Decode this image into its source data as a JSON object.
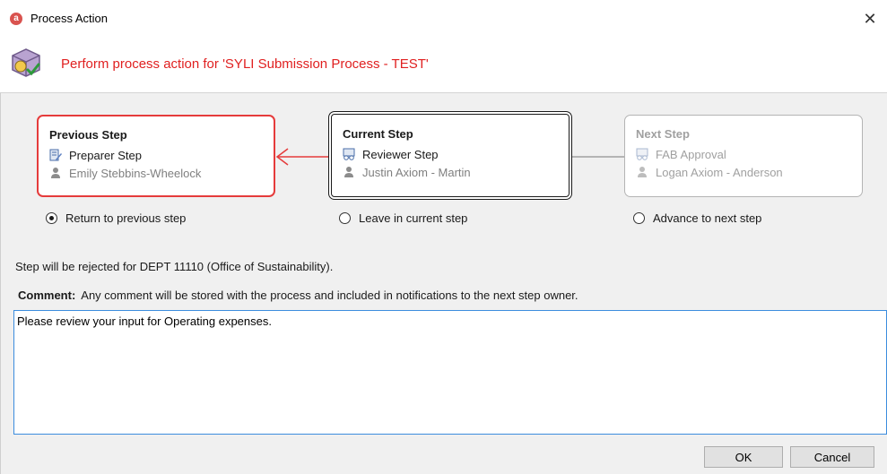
{
  "window": {
    "title": "Process Action",
    "app_icon_letter": "a",
    "close_label": "✕"
  },
  "header": {
    "text": "Perform process action for 'SYLI Submission Process - TEST'"
  },
  "steps": {
    "previous": {
      "heading": "Previous Step",
      "step_name": "Preparer Step",
      "user": "Emily Stebbins-Wheelock"
    },
    "current": {
      "heading": "Current Step",
      "step_name": "Reviewer Step",
      "user": "Justin Axiom - Martin"
    },
    "next": {
      "heading": "Next Step",
      "step_name": "FAB Approval",
      "user": "Logan Axiom - Anderson"
    }
  },
  "options": {
    "return_label": "Return to previous step",
    "leave_label": "Leave in current step",
    "advance_label": "Advance to next step",
    "selected": "return"
  },
  "status_message": "Step will be rejected for DEPT 11110 (Office of Sustainability).",
  "comment": {
    "label": "Comment:",
    "hint": "Any comment will be stored with the process and included in notifications to the next step owner.",
    "value": "Please review your input for Operating expenses."
  },
  "buttons": {
    "ok": "OK",
    "cancel": "Cancel"
  },
  "colors": {
    "accent_red": "#e53b3b",
    "header_red": "#e02020",
    "focus_blue": "#3c8dde",
    "disabled_gray": "#a0a0a0"
  },
  "icons": {
    "app": "app-logo-icon",
    "header": "process-action-icon",
    "previous_step": "edit-document-icon",
    "current_step": "review-icon",
    "next_step": "approval-icon",
    "user": "user-icon"
  }
}
